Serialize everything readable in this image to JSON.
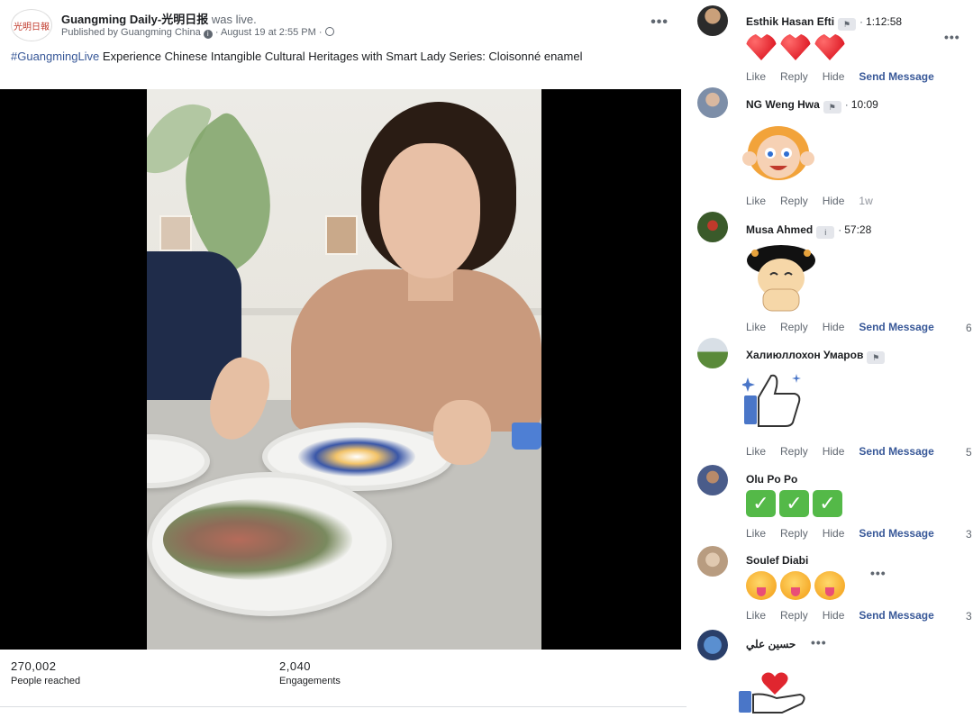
{
  "post": {
    "avatar_text": "光明日報",
    "page_name": "Guangming Daily-光明日报",
    "was_live": "was live.",
    "published_by": "Published by Guangming China",
    "date": "August 19 at 2:55 PM",
    "hashtag": "#GuangmingLive",
    "text": "Experience Chinese Intangible Cultural Heritages with Smart Lady Series: Cloisonné enamel",
    "stats": [
      {
        "value": "270,002",
        "label": "People reached"
      },
      {
        "value": "2,040",
        "label": "Engagements"
      }
    ]
  },
  "comments": [
    {
      "name": "Esthik Hasan Efti",
      "time": "1:12:58",
      "content": "hearts",
      "actions": [
        "Like",
        "Reply",
        "Hide"
      ],
      "send": "Send Message"
    },
    {
      "name": "NG Weng Hwa",
      "time": "10:09",
      "content": "sticker-girl",
      "actions": [
        "Like",
        "Reply",
        "Hide"
      ],
      "age": "1w"
    },
    {
      "name": "Musa Ahmed",
      "time": "57:28",
      "content": "sticker-cartoon",
      "actions": [
        "Like",
        "Reply",
        "Hide"
      ],
      "send": "Send Message",
      "trail": "6"
    },
    {
      "name": "Халиюллохон Умаров",
      "content": "sticker-thumbsup",
      "actions": [
        "Like",
        "Reply",
        "Hide"
      ],
      "send": "Send Message",
      "trail": "5"
    },
    {
      "name": "Olu Po Po",
      "content": "checks",
      "actions": [
        "Like",
        "Reply",
        "Hide"
      ],
      "send": "Send Message",
      "trail": "3"
    },
    {
      "name": "Soulef Diabi",
      "content": "tongues",
      "actions": [
        "Like",
        "Reply",
        "Hide"
      ],
      "send": "Send Message",
      "trail": "3"
    },
    {
      "name": "حسين علي",
      "content": "sticker-heart-hand"
    }
  ]
}
